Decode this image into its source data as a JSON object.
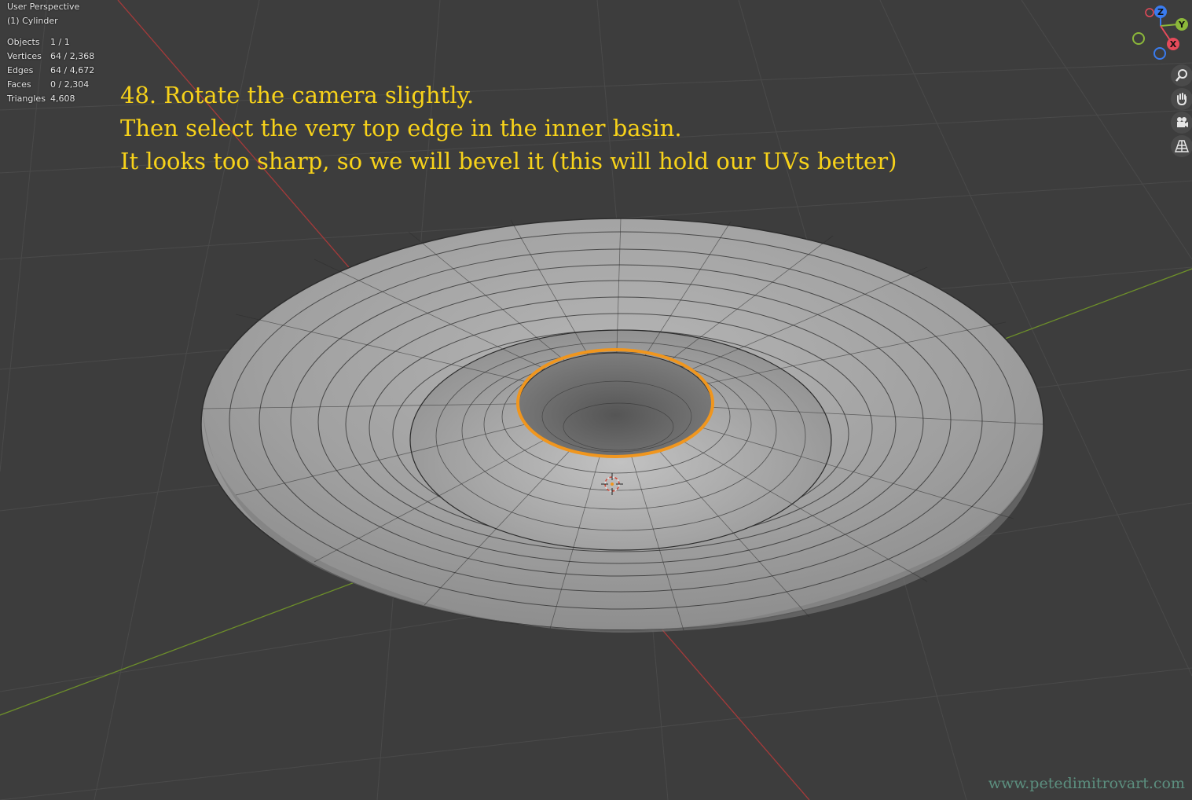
{
  "viewport": {
    "view_name": "User Perspective",
    "object_name": "(1) Cylinder"
  },
  "stats": [
    {
      "label": "Objects",
      "value": "1 / 1"
    },
    {
      "label": "Vertices",
      "value": "64 / 2,368"
    },
    {
      "label": "Edges",
      "value": "64 / 4,672"
    },
    {
      "label": "Faces",
      "value": "0 / 2,304"
    },
    {
      "label": "Triangles",
      "value": "4,608"
    }
  ],
  "instruction": {
    "line1": "48. Rotate the camera slightly.",
    "line2": "Then select the very top edge in the inner basin.",
    "line3": "It looks too sharp, so we will bevel it (this will hold our UVs better)"
  },
  "gizmo": {
    "z_label": "Z",
    "y_label": "Y",
    "x_label": "X",
    "x_color": "#e64a5a",
    "y_color": "#8cb83a",
    "z_color": "#3a7cf0"
  },
  "nav_icons": [
    "zoom-icon",
    "hand-pan-icon",
    "camera-icon",
    "grid-perspective-icon"
  ],
  "watermark": "www.petedimitrovart.com",
  "colors": {
    "background": "#3d3d3d",
    "instruction_text": "#f7d21a",
    "selected_edge": "#f0961e",
    "x_axis": "#a63a3a",
    "y_axis": "#6d8f2a",
    "mesh": "#9c9c9c"
  }
}
